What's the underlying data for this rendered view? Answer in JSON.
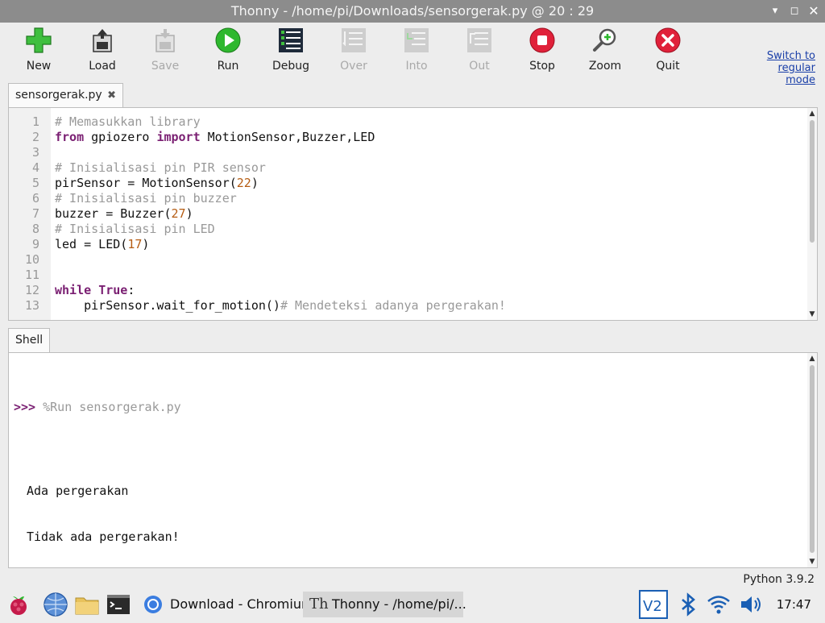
{
  "window": {
    "title": "Thonny  -  /home/pi/Downloads/sensorgerak.py  @  20 : 29",
    "controls": [
      "minimize-icon",
      "maximize-icon",
      "close-icon"
    ]
  },
  "toolbar": {
    "buttons": [
      {
        "label": "New",
        "icon": "new-file-icon",
        "enabled": true
      },
      {
        "label": "Load",
        "icon": "load-icon",
        "enabled": true
      },
      {
        "label": "Save",
        "icon": "save-icon",
        "enabled": false
      },
      {
        "label": "Run",
        "icon": "run-icon",
        "enabled": true
      },
      {
        "label": "Debug",
        "icon": "debug-icon",
        "enabled": true
      },
      {
        "label": "Over",
        "icon": "step-over-icon",
        "enabled": false
      },
      {
        "label": "Into",
        "icon": "step-into-icon",
        "enabled": false
      },
      {
        "label": "Out",
        "icon": "step-out-icon",
        "enabled": false
      },
      {
        "label": "Stop",
        "icon": "stop-icon",
        "enabled": true
      },
      {
        "label": "Zoom",
        "icon": "zoom-icon",
        "enabled": true
      },
      {
        "label": "Quit",
        "icon": "quit-icon",
        "enabled": true
      }
    ],
    "switch_mode": [
      "Switch to",
      "regular",
      "mode"
    ]
  },
  "editor": {
    "tab_label": "sensorgerak.py",
    "tab_close": "✖",
    "line_numbers": [
      "1",
      "2",
      "3",
      "4",
      "5",
      "6",
      "7",
      "8",
      "9",
      "10",
      "11",
      "12",
      "13"
    ],
    "lines": [
      "# Memasukkan library",
      "from gpiozero import MotionSensor,Buzzer,LED",
      "",
      "# Inisialisasi pin PIR sensor",
      "pirSensor = MotionSensor(22)",
      "# Inisialisasi pin buzzer",
      "buzzer = Buzzer(27)",
      "# Inisialisasi pin LED",
      "led = LED(17)",
      "",
      "",
      "while True:",
      "    pirSensor.wait_for_motion()# Mendeteksi adanya pergerakan!"
    ]
  },
  "shell": {
    "tab_label": "Shell",
    "prompt": ">>>",
    "command": "%Run sensorgerak.py",
    "output": [
      "Ada pergerakan",
      "Tidak ada pergerakan!"
    ]
  },
  "status": {
    "interpreter": "Python 3.9.2"
  },
  "taskbar": {
    "launchers": [
      "raspberry-menu-icon",
      "web-browser-icon",
      "file-manager-icon",
      "terminal-icon"
    ],
    "tasks": [
      {
        "label": "Download - Chromium",
        "icon": "chromium-icon",
        "active": false
      },
      {
        "label": "Thonny  -  /home/pi/...",
        "icon": "thonny-icon",
        "active": true
      }
    ],
    "tray": [
      "vnc-icon",
      "bluetooth-icon",
      "wifi-icon",
      "volume-icon"
    ],
    "clock": "17:47"
  },
  "colors": {
    "keyword": "#7a1f72",
    "comment": "#999999",
    "number": "#b55c12",
    "run_green": "#2eb82e",
    "stop_red": "#e0213a",
    "titlebar": "#8c8c8c"
  }
}
